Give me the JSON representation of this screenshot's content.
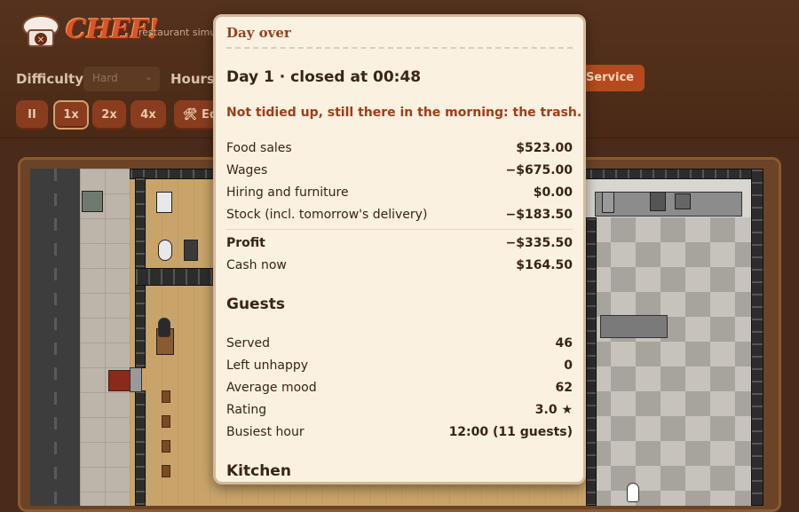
{
  "app": {
    "logo_text": "CHEF!",
    "tagline": "restaurant simu"
  },
  "controls": {
    "difficulty_label": "Difficulty",
    "difficulty_value": "Hard",
    "hours_label": "Hours",
    "start_label": "rt Service",
    "pause_label": "II",
    "speeds": [
      "1x",
      "2x",
      "4x"
    ],
    "active_speed": "1x",
    "edit_label": "🛠 Ed"
  },
  "modal": {
    "title": "Day over",
    "day_heading": "Day 1 · closed at 00:48",
    "warning": "Not tidied up, still there in the morning: the trash.",
    "finance": [
      {
        "label": "Food sales",
        "value": "$523.00"
      },
      {
        "label": "Wages",
        "value": "−$675.00"
      },
      {
        "label": "Hiring and furniture",
        "value": "$0.00"
      },
      {
        "label": "Stock (incl. tomorrow's delivery)",
        "value": "−$183.50"
      }
    ],
    "profit": {
      "label": "Profit",
      "value": "−$335.50"
    },
    "cash": {
      "label": "Cash now",
      "value": "$164.50"
    },
    "guests_heading": "Guests",
    "guests": [
      {
        "label": "Served",
        "value": "46"
      },
      {
        "label": "Left unhappy",
        "value": "0"
      },
      {
        "label": "Average mood",
        "value": "62"
      },
      {
        "label": "Rating",
        "value": "3.0 ★"
      },
      {
        "label": "Busiest hour",
        "value": "12:00 (11 guests)"
      }
    ],
    "kitchen_heading": "Kitchen"
  }
}
